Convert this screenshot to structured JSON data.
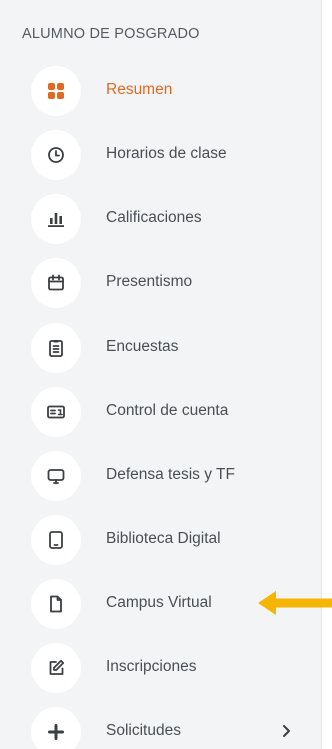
{
  "sidebar": {
    "section_title": "ALUMNO DE POSGRADO",
    "accent_color": "#e06a22",
    "arrow_color": "#f5b500",
    "items": [
      {
        "label": "Resumen",
        "icon": "dashboard-grid-icon",
        "active": true
      },
      {
        "label": "Horarios de clase",
        "icon": "clock-icon"
      },
      {
        "label": "Calificaciones",
        "icon": "bar-chart-icon"
      },
      {
        "label": "Presentismo",
        "icon": "calendar-icon"
      },
      {
        "label": "Encuestas",
        "icon": "clipboard-icon"
      },
      {
        "label": "Control de cuenta",
        "icon": "id-card-icon"
      },
      {
        "label": "Defensa tesis y TF",
        "icon": "monitor-icon"
      },
      {
        "label": "Biblioteca Digital",
        "icon": "tablet-icon"
      },
      {
        "label": "Campus Virtual",
        "icon": "document-icon"
      },
      {
        "label": "Inscripciones",
        "icon": "edit-icon"
      },
      {
        "label": "Solicitudes",
        "icon": "plus-icon",
        "chevron": "chevron-right-icon"
      }
    ]
  }
}
